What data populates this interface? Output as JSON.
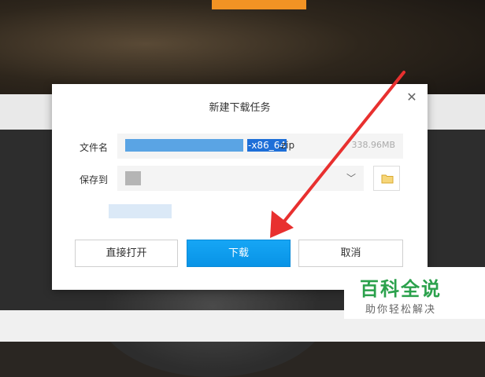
{
  "dialog": {
    "title": "新建下载任务",
    "file_label": "文件名",
    "file_name_selected": "-x86_64",
    "file_name_suffix": ".zip",
    "file_size": "338.96MB",
    "save_label": "保存到",
    "buttons": {
      "open_direct": "直接打开",
      "download": "下载",
      "cancel": "取消"
    }
  },
  "watermark": {
    "main": "百科全说",
    "sub": "助你轻松解决"
  },
  "colors": {
    "accent_blue": "#0893e6",
    "arrow_red": "#e8302f",
    "watermark_green": "#2ba14c"
  }
}
